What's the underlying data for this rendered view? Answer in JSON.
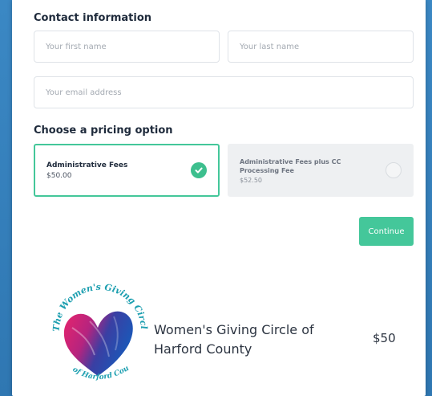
{
  "contact": {
    "title": "Contact information",
    "first_name_placeholder": "Your first name",
    "last_name_placeholder": "Your last name",
    "email_placeholder": "Your email address"
  },
  "pricing": {
    "title": "Choose a pricing option",
    "options": [
      {
        "name": "Administrative Fees",
        "price": "$50.00",
        "selected": true
      },
      {
        "name": "Administrative Fees plus CC Processing Fee",
        "price": "$52.50",
        "selected": false
      }
    ]
  },
  "actions": {
    "continue_label": "Continue"
  },
  "organization": {
    "logo_top_text": "The Women's Giving Circle",
    "logo_bottom_text": "of Harford County",
    "name": "Women's Giving Circle of Harford County",
    "price": "$50"
  },
  "colors": {
    "accent": "#44c79a",
    "background": "#3585c0"
  }
}
